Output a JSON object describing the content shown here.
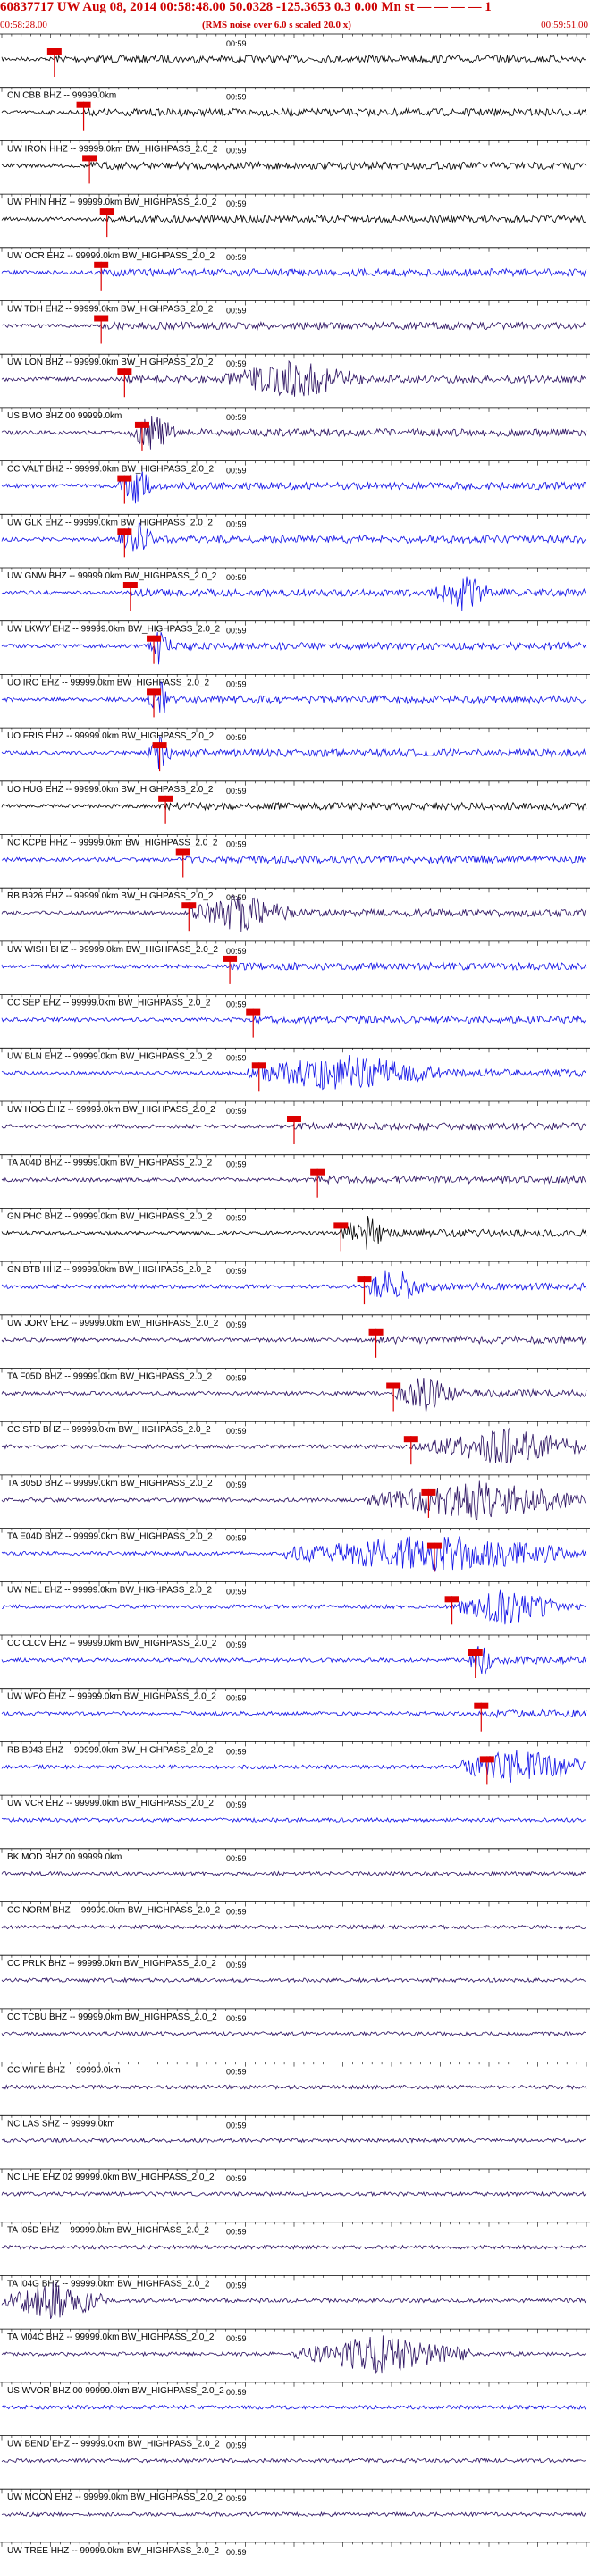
{
  "header": {
    "title": "60837717 UW Aug 08, 2014 00:58:48.00    50.0328 -125.3653  0.3 0.00 Mn st — — — — 1",
    "start_time": "00:58:28.00",
    "noise_note": "(RMS noise over 6.0 s scaled 20.0 x)",
    "end_time": "00:59:51.00"
  },
  "colors": {
    "header_red": "#cc0000",
    "pick_red": "#dd0000",
    "trace_black": "#000000",
    "trace_navy": "#2a1060",
    "trace_blue": "#1010e6",
    "grid": "#000000"
  },
  "tick_label": "00:59",
  "traces": [
    {
      "label": "",
      "color": "black",
      "pick": 0.09,
      "burst": null
    },
    {
      "label": "CN CBB BHZ -- 99999.0km",
      "color": "black",
      "pick": 0.14,
      "burst": null
    },
    {
      "label": "UW IRON HHZ -- 99999.0km BW_HIGHPASS_2.0_2",
      "color": "black",
      "pick": 0.15,
      "burst": null
    },
    {
      "label": "UW PHIN HHZ -- 99999.0km BW_HIGHPASS_2.0_2",
      "color": "black",
      "pick": 0.18,
      "burst": null
    },
    {
      "label": "UW OCR EHZ -- 99999.0km BW_HIGHPASS_2.0_2",
      "color": "blue",
      "pick": 0.17,
      "burst": null
    },
    {
      "label": "UW TDH EHZ -- 99999.0km BW_HIGHPASS_2.0_2",
      "color": "navy",
      "pick": 0.17,
      "burst": null
    },
    {
      "label": "UW LON BHZ -- 99999.0km BW_HIGHPASS_2.0_2",
      "color": "navy",
      "pick": 0.21,
      "burst": [
        0.38,
        0.62
      ]
    },
    {
      "label": "US BMO BHZ 00 99999.0km",
      "color": "navy",
      "pick": 0.24,
      "burst": [
        0.22,
        0.3
      ]
    },
    {
      "label": "CC VALT BHZ -- 99999.0km BW_HIGHPASS_2.0_2",
      "color": "blue",
      "pick": 0.21,
      "burst": [
        0.2,
        0.26
      ]
    },
    {
      "label": "UW GLK EHZ -- 99999.0km BW_HIGHPASS_2.0_2",
      "color": "blue",
      "pick": 0.21,
      "burst": [
        0.2,
        0.26
      ]
    },
    {
      "label": "UW GNW BHZ -- 99999.0km BW_HIGHPASS_2.0_2",
      "color": "blue",
      "pick": 0.22,
      "burst": [
        0.74,
        0.84
      ]
    },
    {
      "label": "UW LKWY EHZ -- 99999.0km BW_HIGHPASS_2.0_2",
      "color": "blue",
      "pick": 0.26,
      "burst": [
        0.25,
        0.29
      ]
    },
    {
      "label": "UO IRO EHZ -- 99999.0km BW_HIGHPASS_2.0_2",
      "color": "blue",
      "pick": 0.26,
      "burst": [
        0.25,
        0.29
      ]
    },
    {
      "label": "UO FRIS EHZ -- 99999.0km BW_HIGHPASS_2.0_2",
      "color": "blue",
      "pick": 0.27,
      "burst": [
        0.25,
        0.29
      ]
    },
    {
      "label": "UO HUG EHZ -- 99999.0km BW_HIGHPASS_2.0_2",
      "color": "black",
      "pick": 0.28,
      "burst": null
    },
    {
      "label": "NC KCPB HHZ -- 99999.0km BW_HIGHPASS_2.0_2",
      "color": "blue",
      "pick": 0.31,
      "burst": null
    },
    {
      "label": "RB B926 EHZ -- 99999.0km BW_HIGHPASS_2.0_2",
      "color": "navy",
      "pick": 0.32,
      "burst": [
        0.32,
        0.5
      ]
    },
    {
      "label": "UW WISH BHZ -- 99999.0km BW_HIGHPASS_2.0_2",
      "color": "blue",
      "pick": 0.39,
      "burst": null
    },
    {
      "label": "CC SEP EHZ -- 99999.0km BW_HIGHPASS_2.0_2",
      "color": "blue",
      "pick": 0.43,
      "burst": null
    },
    {
      "label": "UW BLN EHZ -- 99999.0km BW_HIGHPASS_2.0_2",
      "color": "blue",
      "pick": 0.44,
      "burst": [
        0.42,
        0.75
      ]
    },
    {
      "label": "UW HOG EHZ -- 99999.0km BW_HIGHPASS_2.0_2",
      "color": "navy",
      "pick": 0.5,
      "burst": null
    },
    {
      "label": "TA A04D BHZ -- 99999.0km BW_HIGHPASS_2.0_2",
      "color": "navy",
      "pick": 0.54,
      "burst": null
    },
    {
      "label": "GN PHC BHZ -- 99999.0km BW_HIGHPASS_2.0_2",
      "color": "black",
      "pick": 0.58,
      "burst": [
        0.58,
        0.66
      ]
    },
    {
      "label": "GN BTB HHZ -- 99999.0km BW_HIGHPASS_2.0_2",
      "color": "blue",
      "pick": 0.62,
      "burst": [
        0.62,
        0.72
      ]
    },
    {
      "label": "UW JORV EHZ -- 99999.0km BW_HIGHPASS_2.0_2",
      "color": "navy",
      "pick": 0.64,
      "burst": null
    },
    {
      "label": "TA F05D BHZ -- 99999.0km BW_HIGHPASS_2.0_2",
      "color": "navy",
      "pick": 0.67,
      "burst": [
        0.67,
        0.78
      ]
    },
    {
      "label": "CC STD BHZ -- 99999.0km BW_HIGHPASS_2.0_2",
      "color": "navy",
      "pick": 0.7,
      "burst": [
        0.73,
        1.0
      ]
    },
    {
      "label": "TA B05D BHZ -- 99999.0km BW_HIGHPASS_2.0_2",
      "color": "navy",
      "pick": 0.73,
      "burst": [
        0.62,
        1.0
      ]
    },
    {
      "label": "TA E04D BHZ -- 99999.0km BW_HIGHPASS_2.0_2",
      "color": "blue",
      "pick": 0.74,
      "burst": [
        0.48,
        1.0
      ]
    },
    {
      "label": "UW NEL EHZ -- 99999.0km BW_HIGHPASS_2.0_2",
      "color": "blue",
      "pick": 0.77,
      "burst": [
        0.78,
        0.95
      ]
    },
    {
      "label": "CC CLCV EHZ -- 99999.0km BW_HIGHPASS_2.0_2",
      "color": "blue",
      "pick": 0.81,
      "burst": [
        0.8,
        0.84
      ]
    },
    {
      "label": "UW WPO EHZ -- 99999.0km BW_HIGHPASS_2.0_2",
      "color": "blue",
      "pick": 0.82,
      "burst": null
    },
    {
      "label": "RB B943 EHZ -- 99999.0km BW_HIGHPASS_2.0_2",
      "color": "blue",
      "pick": 0.83,
      "burst": [
        0.78,
        1.0
      ]
    },
    {
      "label": "UW VCR EHZ -- 99999.0km BW_HIGHPASS_2.0_2",
      "color": "blue",
      "pick": null,
      "burst": null
    },
    {
      "label": "BK MOD BHZ 00 99999.0km",
      "color": "navy",
      "pick": null,
      "burst": null
    },
    {
      "label": "CC NORM BHZ -- 99999.0km BW_HIGHPASS_2.0_2",
      "color": "navy",
      "pick": null,
      "burst": null
    },
    {
      "label": "CC PRLK BHZ -- 99999.0km BW_HIGHPASS_2.0_2",
      "color": "navy",
      "pick": null,
      "burst": null
    },
    {
      "label": "CC TCBU BHZ -- 99999.0km BW_HIGHPASS_2.0_2",
      "color": "navy",
      "pick": null,
      "burst": null
    },
    {
      "label": "CC WIFE BHZ -- 99999.0km",
      "color": "navy",
      "pick": null,
      "burst": null
    },
    {
      "label": "NC LAS SHZ -- 99999.0km",
      "color": "navy",
      "pick": null,
      "burst": null
    },
    {
      "label": "NC LHE EHZ 02 99999.0km BW_HIGHPASS_2.0_2",
      "color": "navy",
      "pick": null,
      "burst": null
    },
    {
      "label": "TA I05D BHZ -- 99999.0km BW_HIGHPASS_2.0_2",
      "color": "navy",
      "pick": null,
      "burst": null
    },
    {
      "label": "TA I04G BHZ -- 99999.0km BW_HIGHPASS_2.0_2",
      "color": "navy",
      "pick": null,
      "burst": [
        0.0,
        0.18
      ]
    },
    {
      "label": "TA M04C BHZ -- 99999.0km BW_HIGHPASS_2.0_2",
      "color": "navy",
      "pick": null,
      "burst": [
        0.5,
        0.8
      ]
    },
    {
      "label": "US WVOR BHZ 00 99999.0km BW_HIGHPASS_2.0_2",
      "color": "blue",
      "pick": null,
      "burst": null
    },
    {
      "label": "UW BEND EHZ -- 99999.0km BW_HIGHPASS_2.0_2",
      "color": "navy",
      "pick": null,
      "burst": null
    },
    {
      "label": "UW MOON EHZ -- 99999.0km BW_HIGHPASS_2.0_2",
      "color": "navy",
      "pick": null,
      "burst": null
    },
    {
      "label": "UW TREE HHZ -- 99999.0km BW_HIGHPASS_2.0_2",
      "color": "navy",
      "pick": null,
      "burst": null
    }
  ]
}
